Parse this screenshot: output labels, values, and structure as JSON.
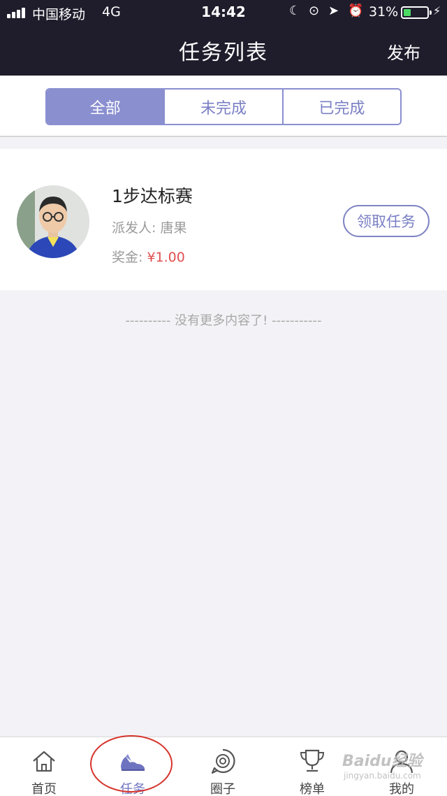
{
  "status_bar": {
    "carrier": "中国移动",
    "network": "4G",
    "time": "14:42",
    "battery": "31%",
    "battery_level": 0.31,
    "battery_color": "#4cd964"
  },
  "nav": {
    "title": "任务列表",
    "publish_label": "发布"
  },
  "filter_tabs": {
    "active_index": 0,
    "items": [
      "全部",
      "未完成",
      "已完成"
    ]
  },
  "task": {
    "title": "1步达标赛",
    "sender_label": "派发人:",
    "sender_name": "唐果",
    "reward_label": "奖金:",
    "reward_amount": "¥1.00",
    "claim_label": "领取任务"
  },
  "list_end_text": "---------- 没有更多内容了! -----------",
  "tabbar": {
    "active_index": 1,
    "items": [
      {
        "label": "首页",
        "icon": "home-icon"
      },
      {
        "label": "任务",
        "icon": "shoe-icon"
      },
      {
        "label": "圈子",
        "icon": "circle-icon"
      },
      {
        "label": "榜单",
        "icon": "trophy-icon"
      },
      {
        "label": "我的",
        "icon": "user-icon"
      }
    ]
  },
  "watermark": {
    "brand": "Baidu经验",
    "url": "jingyan.baidu.com"
  },
  "colors": {
    "accent": "#8a8fd0",
    "header_bg": "#1f1d2c",
    "price": "#e05050",
    "highlight_ring": "#d6342c"
  }
}
